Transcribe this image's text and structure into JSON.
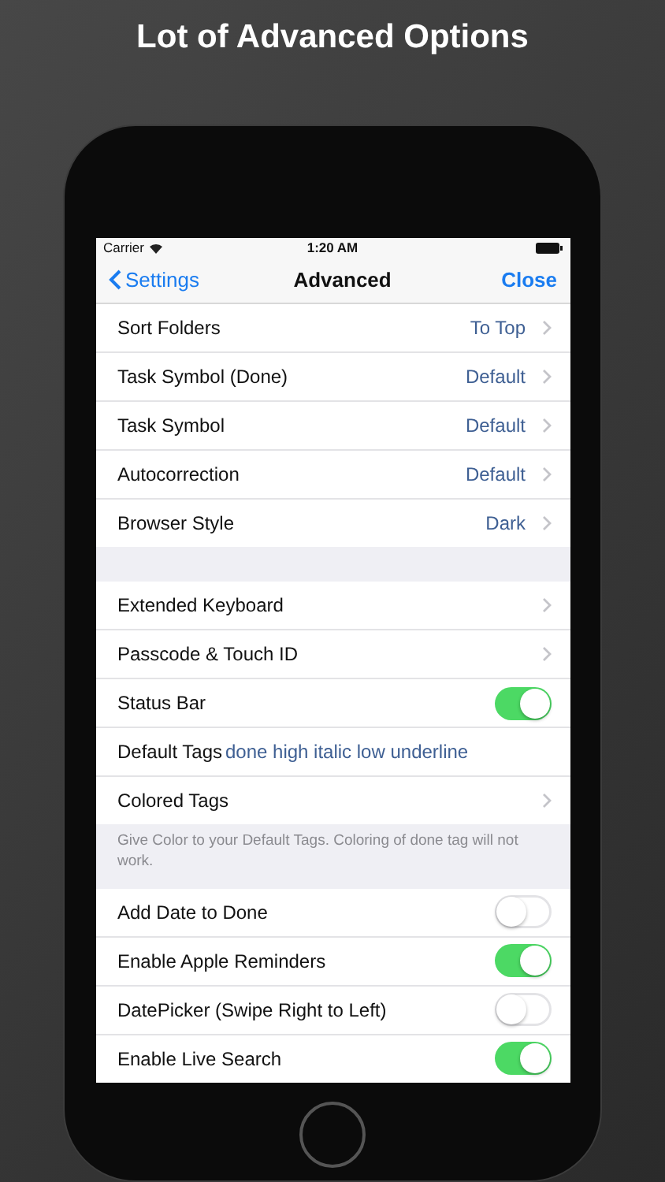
{
  "headline": "Lot of Advanced Options",
  "status_bar": {
    "carrier": "Carrier",
    "time": "1:20 AM"
  },
  "nav_bar": {
    "back": "Settings",
    "title": "Advanced",
    "action": "Close"
  },
  "groups": [
    {
      "rows": [
        {
          "kind": "value",
          "label": "Sort Folders",
          "value": "To Top"
        },
        {
          "kind": "value",
          "label": "Task Symbol (Done)",
          "value": "Default"
        },
        {
          "kind": "value",
          "label": "Task Symbol",
          "value": "Default"
        },
        {
          "kind": "value",
          "label": "Autocorrection",
          "value": "Default"
        },
        {
          "kind": "value",
          "label": "Browser Style",
          "value": "Dark"
        }
      ]
    },
    {
      "rows": [
        {
          "kind": "link",
          "label": "Extended Keyboard"
        },
        {
          "kind": "link",
          "label": "Passcode & Touch ID"
        },
        {
          "kind": "toggle",
          "label": "Status Bar",
          "on": true
        },
        {
          "kind": "tags",
          "label": "Default Tags",
          "value": "done high italic low underline"
        },
        {
          "kind": "link",
          "label": "Colored Tags"
        }
      ],
      "footer": "Give Color to your Default Tags. Coloring of done tag will not work."
    },
    {
      "rows": [
        {
          "kind": "toggle",
          "label": "Add Date to Done",
          "on": false
        },
        {
          "kind": "toggle",
          "label": "Enable Apple Reminders",
          "on": true
        },
        {
          "kind": "toggle",
          "label": "DatePicker (Swipe Right to Left)",
          "on": false
        },
        {
          "kind": "toggle",
          "label": "Enable Live Search",
          "on": true
        }
      ]
    }
  ]
}
